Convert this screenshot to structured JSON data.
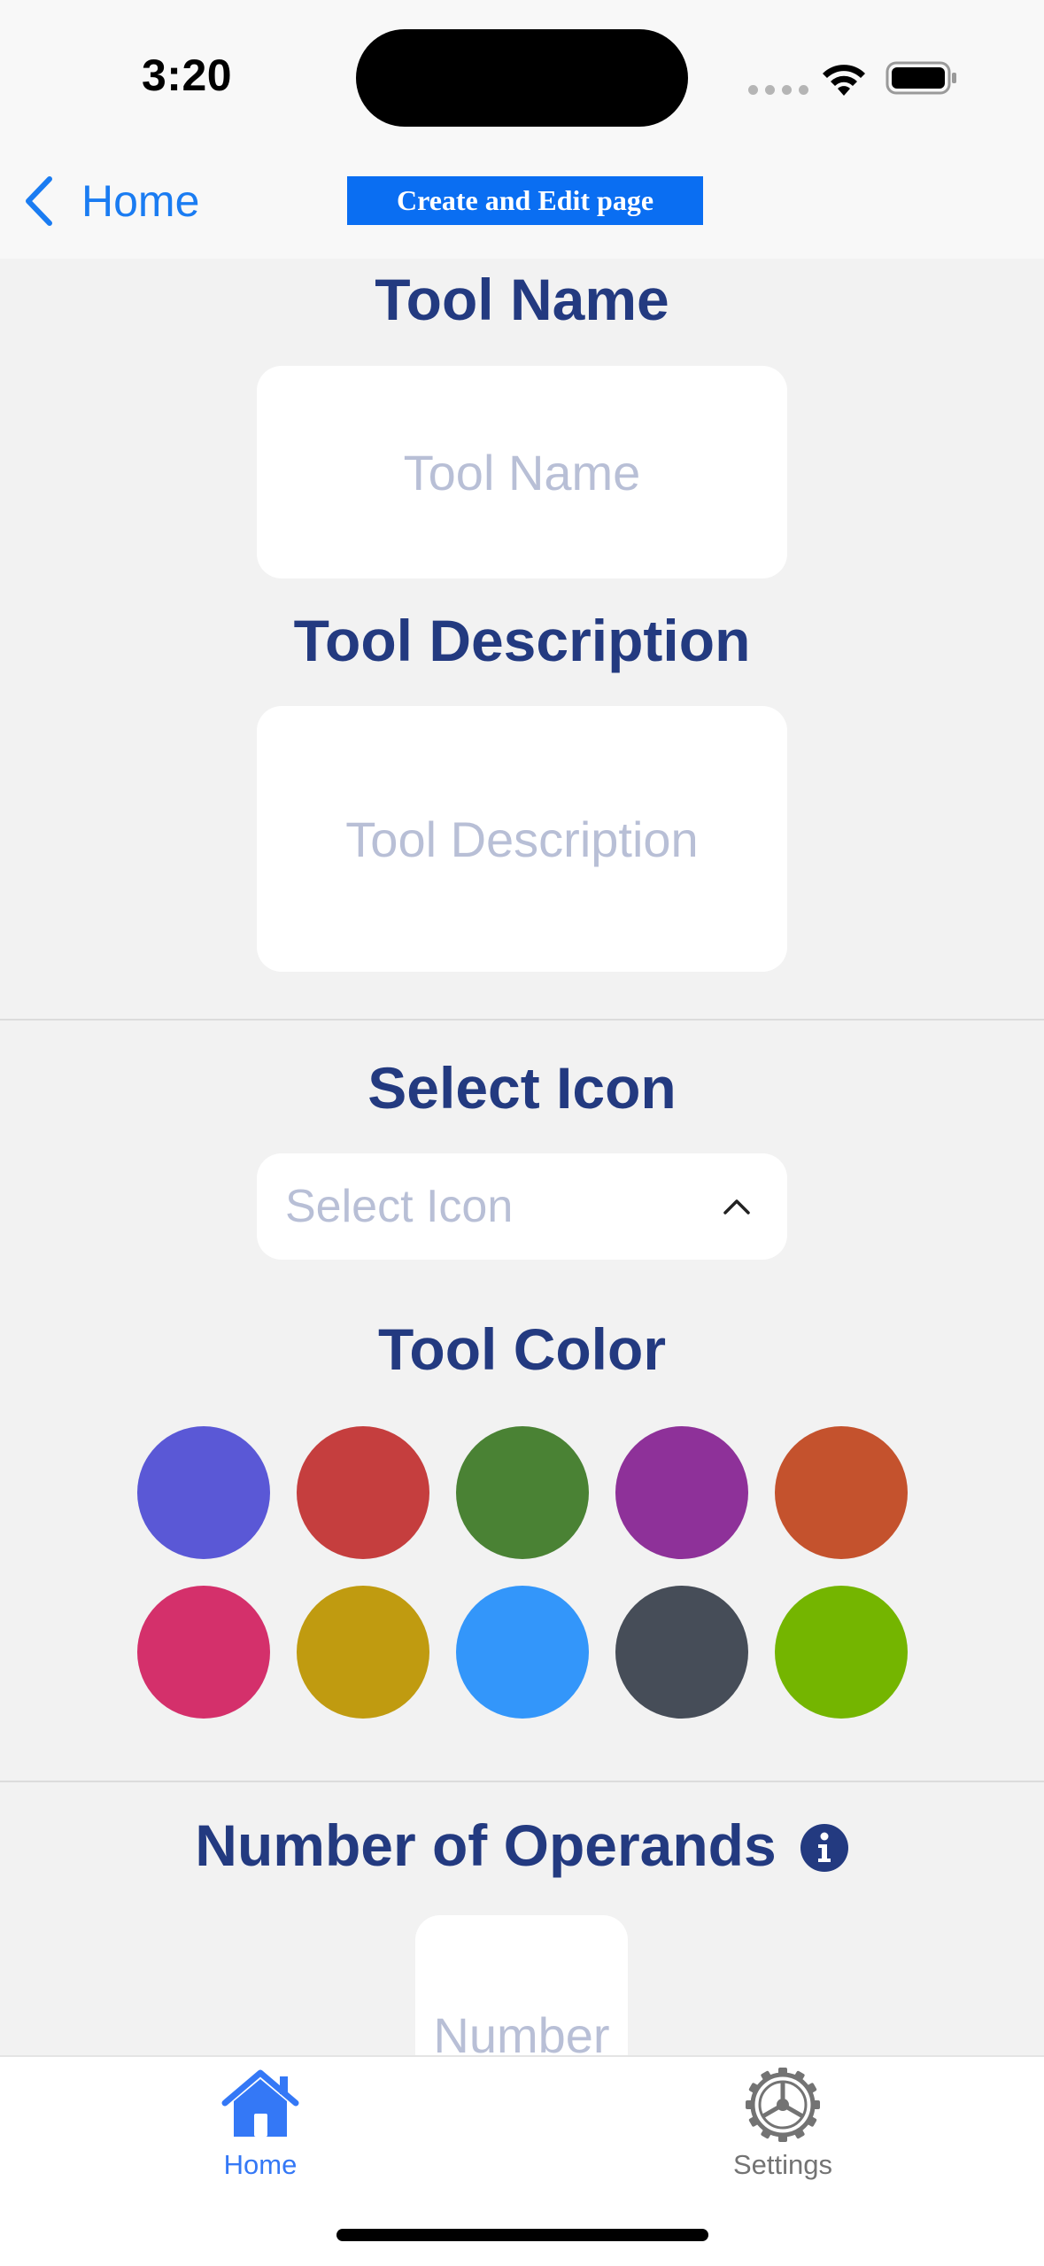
{
  "status_bar": {
    "time": "3:20"
  },
  "nav": {
    "back_label": "Home",
    "title": "Create and Edit page"
  },
  "tool_name": {
    "heading": "Tool Name",
    "placeholder": "Tool Name"
  },
  "tool_description": {
    "heading": "Tool Description",
    "placeholder": "Tool Description"
  },
  "icon_select": {
    "heading": "Select Icon",
    "placeholder": "Select Icon"
  },
  "tool_color": {
    "heading": "Tool Color",
    "swatches": [
      "#5a58d6",
      "#c53e3e",
      "#4a8234",
      "#8e3199",
      "#c4522d",
      "#d4306b",
      "#c09b10",
      "#3396fa",
      "#464d58",
      "#74b500"
    ]
  },
  "operands": {
    "heading": "Number of Operands",
    "placeholder": "Number"
  },
  "tab_bar": {
    "tabs": [
      {
        "label": "Home",
        "icon": "house-icon",
        "active": true,
        "color": "#3478f6"
      },
      {
        "label": "Settings",
        "icon": "gear-icon",
        "active": false,
        "color": "#737373"
      }
    ]
  }
}
